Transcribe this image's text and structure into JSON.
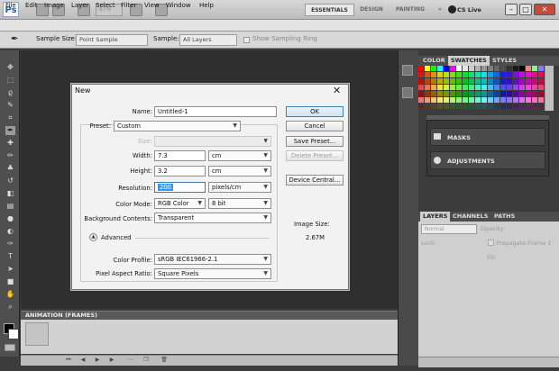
{
  "app": {
    "logo_text": "Ps",
    "zoom": "67%",
    "workspaces": [
      "ESSENTIALS",
      "DESIGN",
      "PAINTING",
      "»"
    ],
    "cs_live": "CS Live",
    "window_controls": [
      "–",
      "□",
      "✕"
    ]
  },
  "menu": [
    "File",
    "Edit",
    "Image",
    "Layer",
    "Select",
    "Filter",
    "View",
    "Window",
    "Help"
  ],
  "options_bar": {
    "sample_size_label": "Sample Size:",
    "sample_size_value": "Point Sample",
    "sample_label": "Sample:",
    "sample_value": "All Layers",
    "show_ring_label": "Show Sampling Ring"
  },
  "panels": {
    "color_tabs": [
      "COLOR",
      "SWATCHES",
      "STYLES"
    ],
    "masks_label": "MASKS",
    "adjustments_label": "ADJUSTMENTS",
    "layers_tabs": [
      "LAYERS",
      "CHANNELS",
      "PATHS"
    ],
    "layers_blend": "Normal",
    "layers_opacity_label": "Opacity:",
    "layers_lock_label": "Lock:",
    "layers_fill_label": "Fill:",
    "layers_propagate": "Propagate Frame 1"
  },
  "animation_panel": {
    "title": "ANIMATION (FRAMES)"
  },
  "dialog": {
    "title": "New",
    "name_label": "Name:",
    "name_value": "Untitled-1",
    "preset_label": "Preset:",
    "preset_value": "Custom",
    "size_label": "Size:",
    "width_label": "Width:",
    "width_value": "7.3",
    "width_unit": "cm",
    "height_label": "Height:",
    "height_value": "3.2",
    "height_unit": "cm",
    "resolution_label": "Resolution:",
    "resolution_value": "200",
    "resolution_unit": "pixels/cm",
    "color_mode_label": "Color Mode:",
    "color_mode_value": "RGB Color",
    "bit_depth": "8 bit",
    "bg_label": "Background Contents:",
    "bg_value": "Transparent",
    "advanced_label": "Advanced",
    "color_profile_label": "Color Profile:",
    "color_profile_value": "sRGB IEC61966-2.1",
    "pixel_ratio_label": "Pixel Aspect Ratio:",
    "pixel_ratio_value": "Square Pixels",
    "buttons": {
      "ok": "OK",
      "cancel": "Cancel",
      "save_preset": "Save Preset...",
      "delete_preset": "Delete Preset...",
      "device_central": "Device Central..."
    },
    "image_size_label": "Image Size:",
    "image_size_value": "2.67M"
  },
  "colors": {
    "accent_blue": "#3399ff",
    "close_red": "#c24b3c"
  }
}
